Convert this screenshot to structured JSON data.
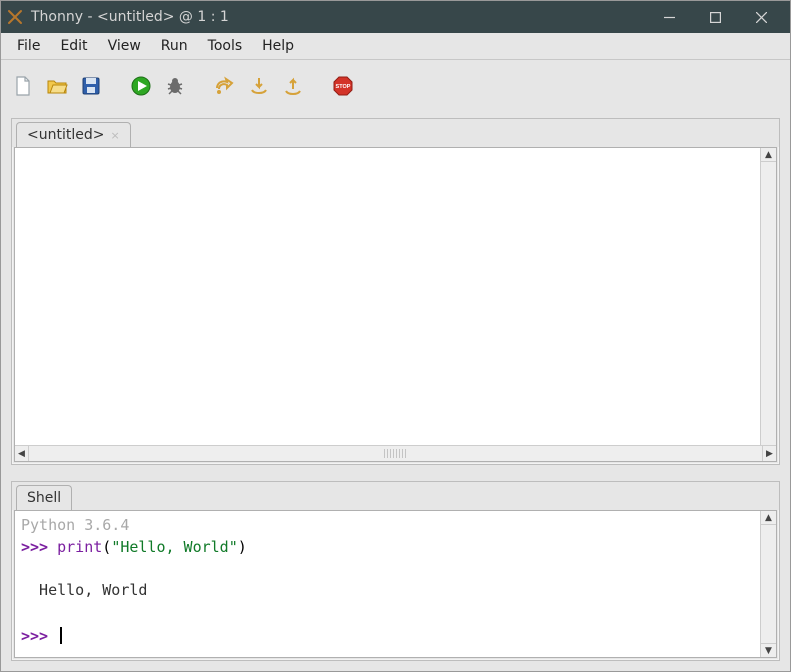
{
  "titlebar": {
    "title": "Thonny  -  <untitled>  @  1 : 1"
  },
  "menubar": {
    "file": "File",
    "edit": "Edit",
    "view": "View",
    "run": "Run",
    "tools": "Tools",
    "help": "Help"
  },
  "toolbar": {
    "new": "new-file-icon",
    "open": "open-file-icon",
    "save": "save-icon",
    "run": "run-icon",
    "debug": "debug-icon",
    "step_over": "step-over-icon",
    "step_into": "step-into-icon",
    "step_out": "step-out-icon",
    "stop": "stop-icon"
  },
  "editor": {
    "tab_label": "<untitled>"
  },
  "shell": {
    "tab_label": "Shell",
    "version_line": "Python 3.6.4",
    "prompt": ">>> ",
    "cmd_func": "print",
    "cmd_open": "(",
    "cmd_str": "\"Hello, World\"",
    "cmd_close": ")",
    "output_line": "  Hello, World"
  }
}
